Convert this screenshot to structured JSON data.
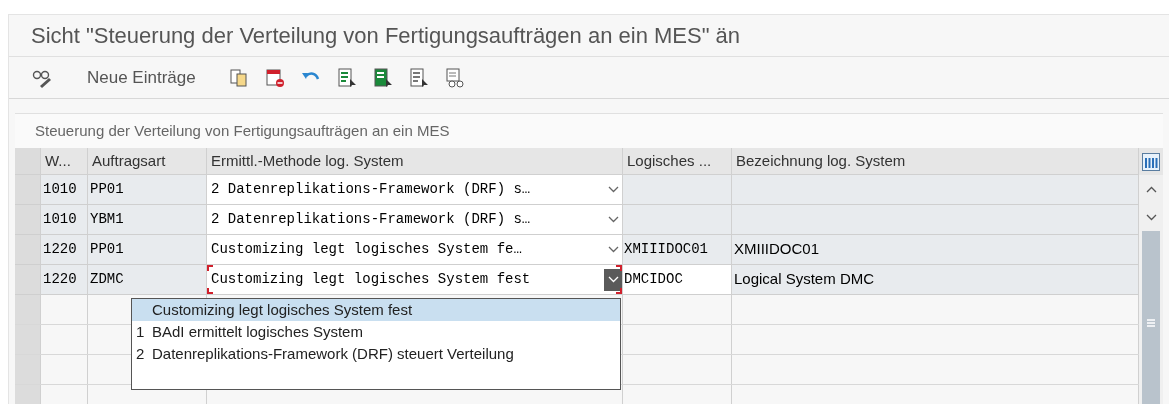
{
  "window": {
    "title": "Sicht \"Steuerung der Verteilung von Fertigungsaufträgen an ein MES\" än"
  },
  "toolbar": {
    "new_entries": "Neue Einträge"
  },
  "table": {
    "caption": "Steuerung der Verteilung von Fertigungsaufträgen an ein MES",
    "columns": [
      "W...",
      "Auftragsart",
      "Ermittl.-Methode log. System",
      "Logisches ...",
      "Bezeichnung log. System"
    ],
    "rows": [
      {
        "werk": "1010",
        "auftragsart": "PP01",
        "methode": "2 Datenreplikations-Framework (DRF) s…",
        "log_system": "",
        "bezeichnung": "",
        "editable": false,
        "focused": false
      },
      {
        "werk": "1010",
        "auftragsart": "YBM1",
        "methode": "2 Datenreplikations-Framework (DRF) s…",
        "log_system": "",
        "bezeichnung": "",
        "editable": false,
        "focused": false
      },
      {
        "werk": "1220",
        "auftragsart": "PP01",
        "methode": "Customizing legt logisches System fe…",
        "log_system": "XMIIIDOC01",
        "bezeichnung": "XMIIIDOC01",
        "editable": false,
        "focused": false
      },
      {
        "werk": "1220",
        "auftragsart": "ZDMC",
        "methode": "Customizing legt logisches System fest",
        "log_system": "DMCIDOC",
        "bezeichnung": "Logical System DMC",
        "editable": true,
        "focused": true
      }
    ]
  },
  "dropdown": {
    "options": [
      {
        "text": "Customizing legt logisches System fest",
        "selected": true
      },
      {
        "key": "1",
        "text": "BAdI ermittelt logisches System",
        "selected": false
      },
      {
        "key": "2",
        "text": "Datenreplikations-Framework (DRF) steuert Verteilung",
        "selected": false
      }
    ]
  }
}
